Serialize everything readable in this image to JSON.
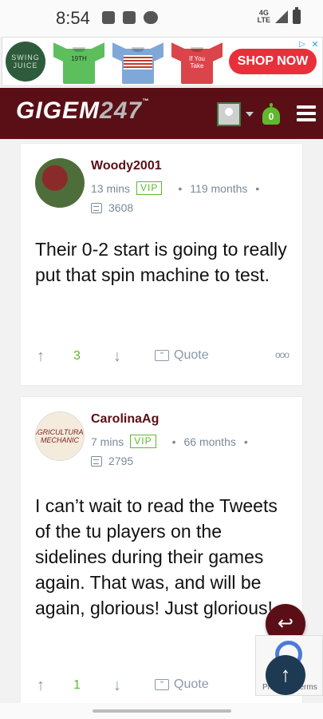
{
  "status": {
    "time": "8:54",
    "network_top": "4G",
    "network_bottom": "LTE"
  },
  "ad": {
    "brand_line1": "SWING",
    "brand_line2": "JUICE",
    "shirt1_print": "19TH",
    "shirt3_print": "If You Take",
    "cta": "SHOP NOW",
    "colors": {
      "shirt1": "#5cbf5c",
      "shirt2": "#7fa8d8",
      "shirt3": "#d9454a",
      "cta": "#e8303a"
    }
  },
  "header": {
    "brand_text": "GIGEM",
    "brand_num": "247",
    "brand_mark": "™",
    "notification_count": "0",
    "colors": {
      "bar": "#5a0f16",
      "accent": "#5fb82e"
    }
  },
  "posts": [
    {
      "username": "Woody2001",
      "time": "13 mins",
      "badge": "VIP",
      "tenure": "119 months",
      "post_count": "3608",
      "body": "Their 0-2 start is going to really put that spin machine to test.",
      "votes": "3",
      "quote_label": "Quote",
      "more_label": "ooo"
    },
    {
      "username": "CarolinaAg",
      "avatar_text": "AGRICULTURAL MECHANIC",
      "time": "7 mins",
      "badge": "VIP",
      "tenure": "66 months",
      "post_count": "2795",
      "body": "I can’t wait to read the Tweets of the tu players on the sidelines during their games again. That was, and will be again, glorious! Just glorious!",
      "votes": "1",
      "quote_label": "Quote"
    }
  ],
  "recaptcha": {
    "text": "Privacy - Terms"
  }
}
